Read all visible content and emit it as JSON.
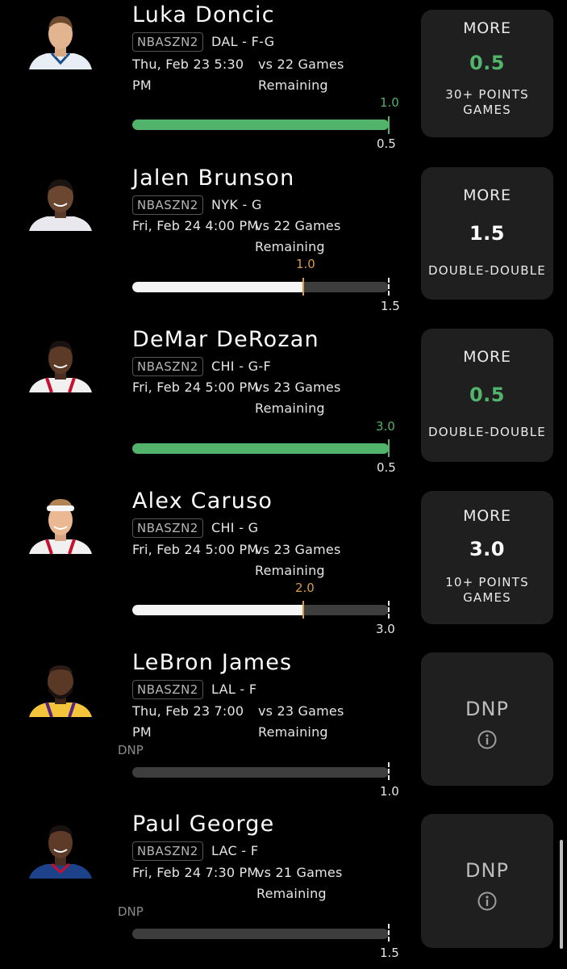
{
  "colors": {
    "background": "#000000",
    "green": "#52b36b",
    "orange": "#d89a45",
    "card": "#1f1f1f"
  },
  "players": [
    {
      "name": "Luka Doncic",
      "badge": "NBASZN2",
      "team_pos": "DAL - F-G",
      "date_line1": "Thu, Feb 23 5:30",
      "date_line2": "PM",
      "opp_line1": "vs 22 Games",
      "opp_line2": "Remaining",
      "current": "1.0",
      "line": "0.5",
      "progress": 1.0,
      "bar_color": "green",
      "pick": {
        "direction": "MORE",
        "line": "0.5",
        "stat": "30+ POINTS GAMES",
        "line_color": "green"
      }
    },
    {
      "name": "Jalen Brunson",
      "badge": "NBASZN2",
      "team_pos": "NYK - G",
      "date_line1": "Fri, Feb 24 4:00 PM",
      "date_line2": "",
      "opp_line1": "vs 22 Games",
      "opp_line2": "Remaining",
      "current": "1.0",
      "line": "1.5",
      "progress": 0.667,
      "bar_color": "white",
      "pick": {
        "direction": "MORE",
        "line": "1.5",
        "stat": "DOUBLE-DOUBLE",
        "line_color": "white"
      }
    },
    {
      "name": "DeMar DeRozan",
      "badge": "NBASZN2",
      "team_pos": "CHI - G-F",
      "date_line1": "Fri, Feb 24 5:00 PM",
      "date_line2": "",
      "opp_line1": "vs 23 Games",
      "opp_line2": "Remaining",
      "current": "3.0",
      "line": "0.5",
      "progress": 1.0,
      "bar_color": "green",
      "pick": {
        "direction": "MORE",
        "line": "0.5",
        "stat": "DOUBLE-DOUBLE",
        "line_color": "green"
      }
    },
    {
      "name": "Alex Caruso",
      "badge": "NBASZN2",
      "team_pos": "CHI - G",
      "date_line1": "Fri, Feb 24 5:00 PM",
      "date_line2": "",
      "opp_line1": "vs 23 Games",
      "opp_line2": "Remaining",
      "current": "2.0",
      "line": "3.0",
      "progress": 0.667,
      "bar_color": "white",
      "pick": {
        "direction": "MORE",
        "line": "3.0",
        "stat": "10+ POINTS GAMES",
        "line_color": "white"
      }
    },
    {
      "name": "LeBron James",
      "badge": "NBASZN2",
      "team_pos": "LAL - F",
      "date_line1": "Thu, Feb 23 7:00",
      "date_line2": "PM",
      "opp_line1": "vs 23 Games",
      "opp_line2": "Remaining",
      "current": "DNP",
      "line": "1.0",
      "progress": 0,
      "bar_color": "none",
      "pick": {
        "status": "DNP",
        "icon": "info-icon"
      }
    },
    {
      "name": "Paul George",
      "badge": "NBASZN2",
      "team_pos": "LAC - F",
      "date_line1": "Fri, Feb 24 7:30 PM",
      "date_line2": "",
      "opp_line1": "vs 21 Games",
      "opp_line2": "Remaining",
      "current": "DNP",
      "line": "1.5",
      "progress": 0,
      "bar_color": "none",
      "pick": {
        "status": "DNP",
        "icon": "info-icon"
      }
    }
  ]
}
